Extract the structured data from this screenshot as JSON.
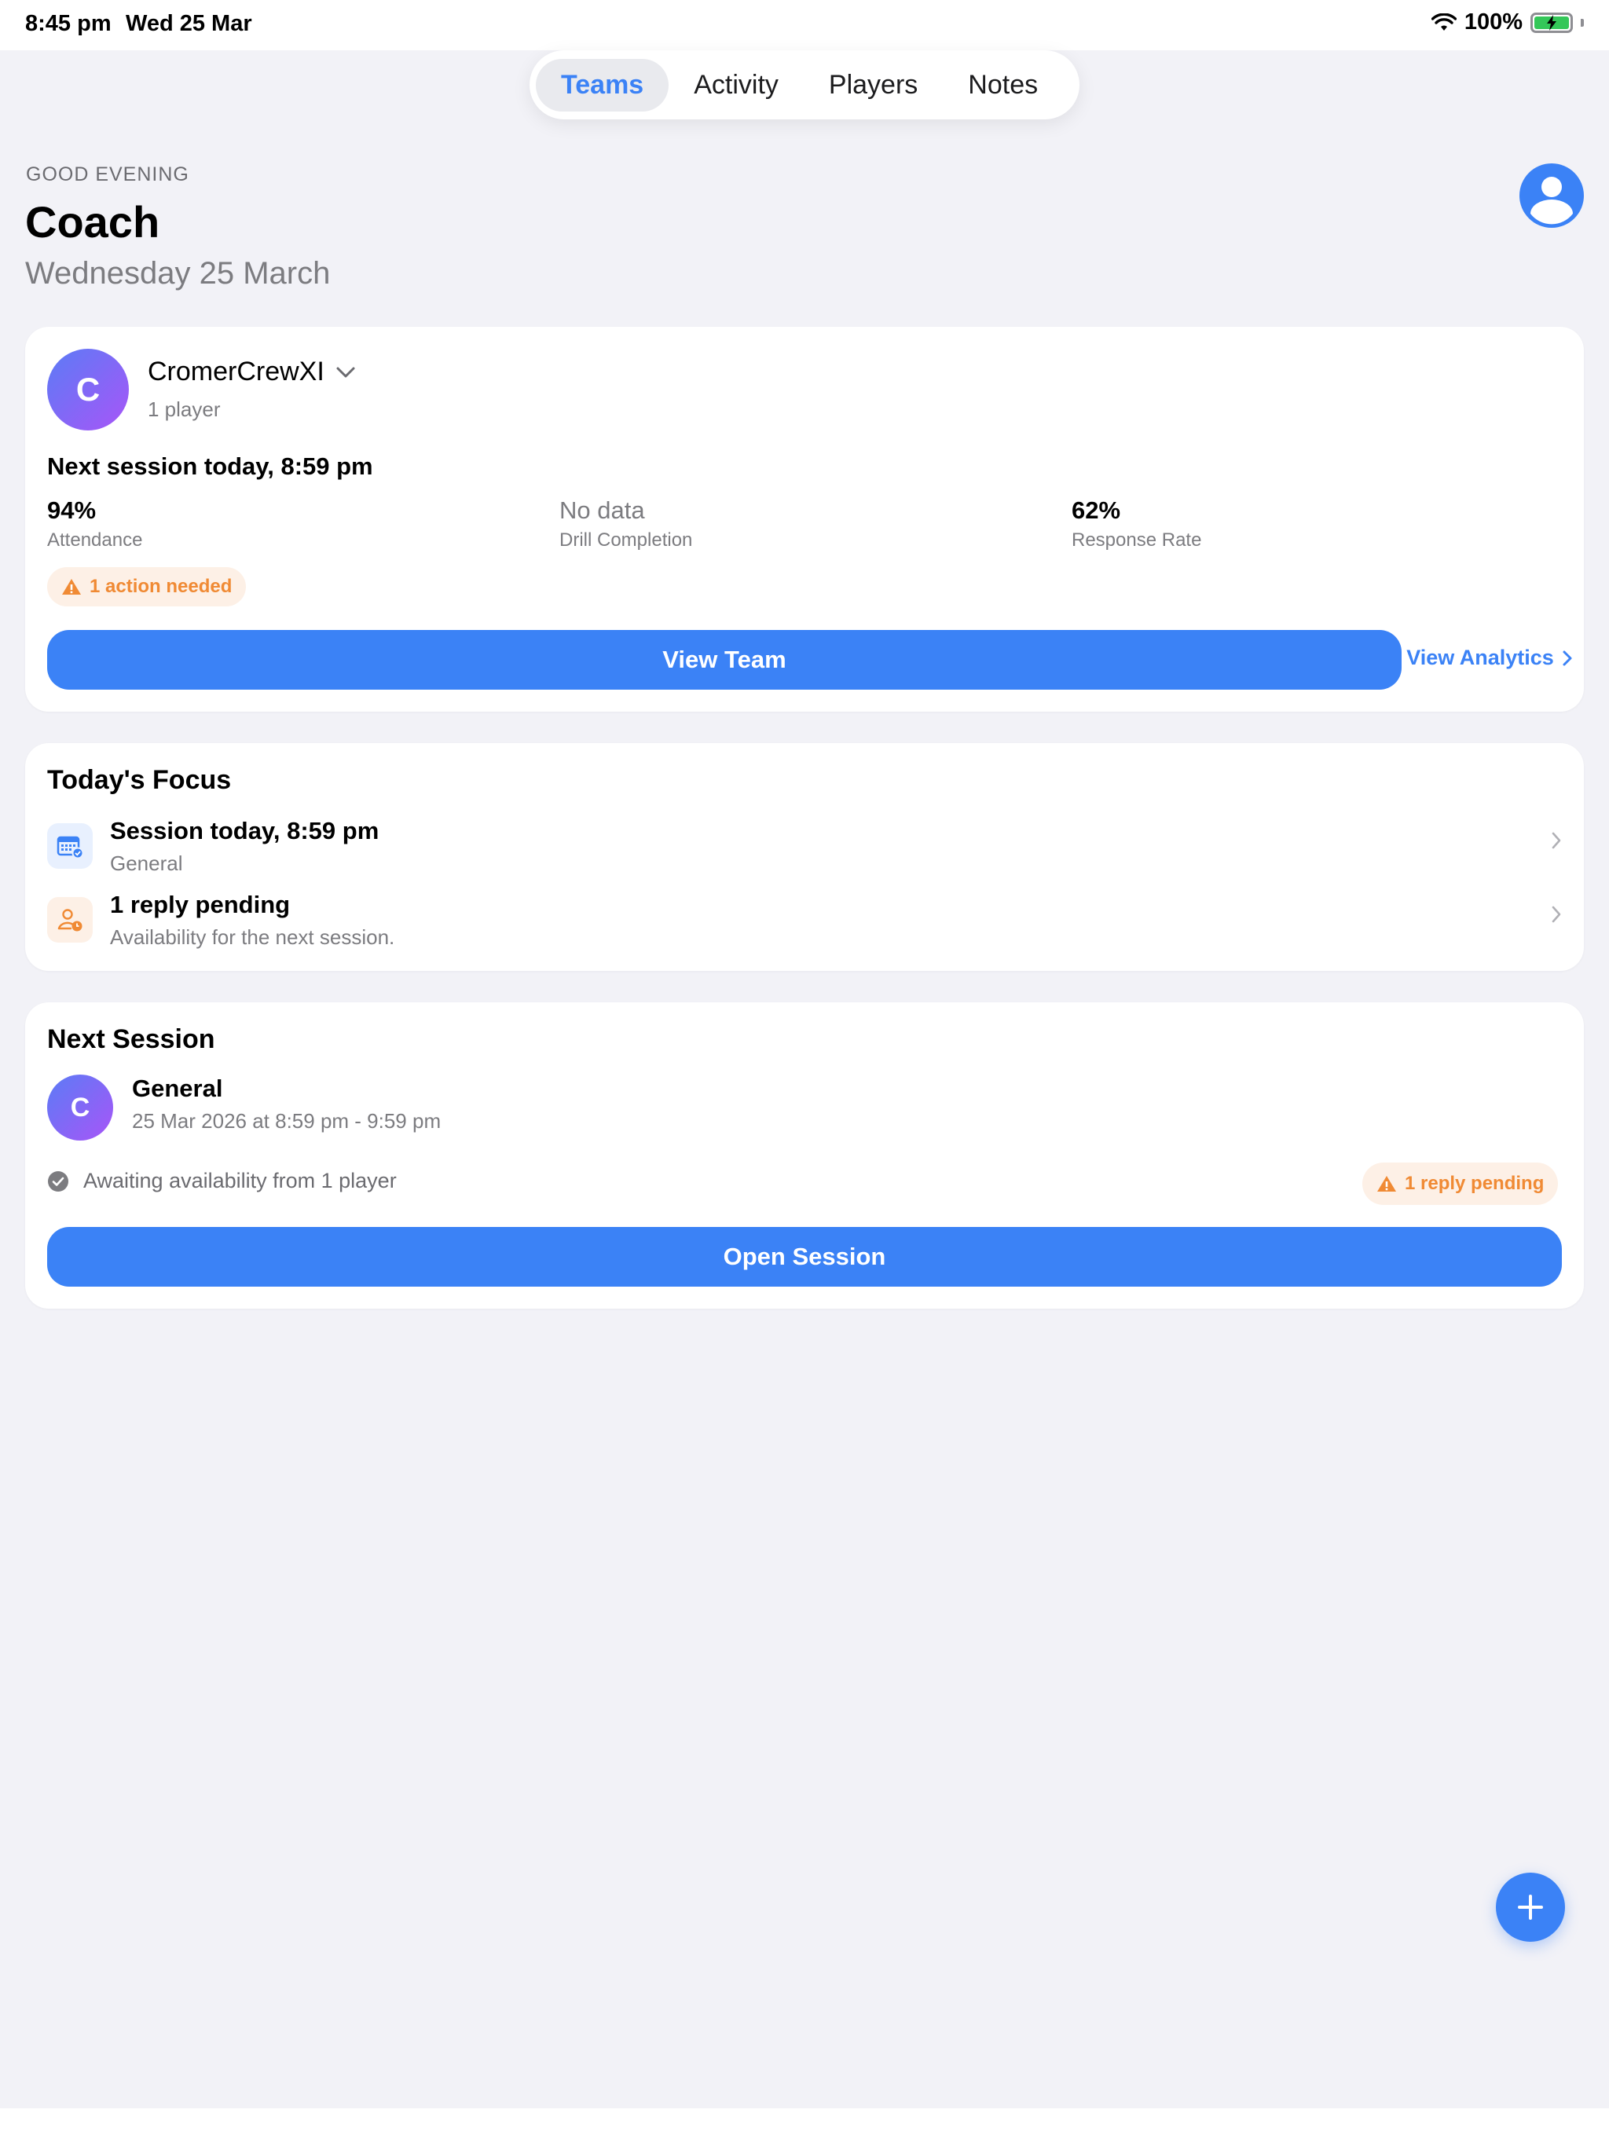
{
  "status_bar": {
    "time": "8:45 pm",
    "date": "Wed 25 Mar",
    "battery": "100%"
  },
  "tabs": [
    {
      "label": "Teams",
      "active": true
    },
    {
      "label": "Activity",
      "active": false
    },
    {
      "label": "Players",
      "active": false
    },
    {
      "label": "Notes",
      "active": false
    }
  ],
  "header": {
    "greeting": "GOOD EVENING",
    "name": "Coach",
    "date": "Wednesday 25 March"
  },
  "team_card": {
    "avatar_letter": "C",
    "team_name": "CromerCrewXI",
    "player_count": "1 player",
    "next_session": "Next session today, 8:59 pm",
    "stats": [
      {
        "value": "94%",
        "label": "Attendance"
      },
      {
        "value": "No data",
        "label": "Drill Completion"
      },
      {
        "value": "62%",
        "label": "Response Rate"
      }
    ],
    "action_badge": "1 action needed",
    "view_team_label": "View Team",
    "view_analytics_label": "View Analytics"
  },
  "focus_card": {
    "title": "Today's Focus",
    "items": [
      {
        "title": "Session today, 8:59 pm",
        "subtitle": "General",
        "icon": "calendar-icon"
      },
      {
        "title": "1 reply pending",
        "subtitle": "Availability for the next session.",
        "icon": "person-clock-icon"
      }
    ]
  },
  "session_card": {
    "title": "Next Session",
    "avatar_letter": "C",
    "session_name": "General",
    "session_time": "25 Mar 2026 at 8:59 pm - 9:59 pm",
    "awaiting_text": "Awaiting availability from 1 player",
    "reply_badge": "1 reply pending",
    "open_label": "Open Session"
  },
  "colors": {
    "accent": "#3b82f6",
    "warning": "#f08a34",
    "background": "#f2f2f7"
  }
}
